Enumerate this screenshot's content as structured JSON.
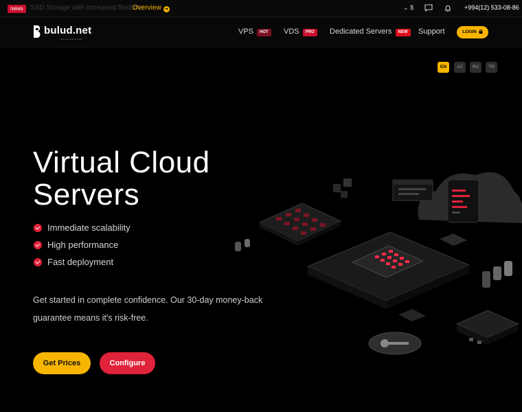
{
  "topbar": {
    "news_badge": "news",
    "news_text": "SSD Storage with increased flexibility",
    "news_link": "Overview",
    "currency": "$",
    "phone": "+994(12) 533-08-86"
  },
  "nav": {
    "logo": "bulud.net",
    "logo_tag": "all in one cloud provider",
    "items": [
      {
        "label": "VPS",
        "badge": "HOT"
      },
      {
        "label": "VDS",
        "badge": "PRO"
      },
      {
        "label": "Dedicated Servers",
        "badge": "NEW"
      },
      {
        "label": "Support"
      }
    ],
    "login": "LOGIN"
  },
  "languages": [
    {
      "code": "EN",
      "active": true
    },
    {
      "code": "AZ",
      "active": false
    },
    {
      "code": "RU",
      "active": false
    },
    {
      "code": "TR",
      "active": false
    }
  ],
  "hero": {
    "title": "Virtual Cloud Servers",
    "features": [
      "Immediate scalability",
      "High performance",
      "Fast deployment"
    ],
    "description": "Get started in complete confidence. Our 30-day money-back guarantee means it's risk-free.",
    "cta_primary": "Get Prices",
    "cta_secondary": "Configure"
  },
  "colors": {
    "accent_yellow": "#f7b500",
    "accent_red": "#e0223a",
    "background": "#000000"
  },
  "icons": {
    "news_link": "arrow-circle-right-icon",
    "currency": "chevron-down-icon",
    "chat": "chat-icon",
    "notification": "bell-icon",
    "login": "lock-icon",
    "feature": "check-circle-icon"
  }
}
